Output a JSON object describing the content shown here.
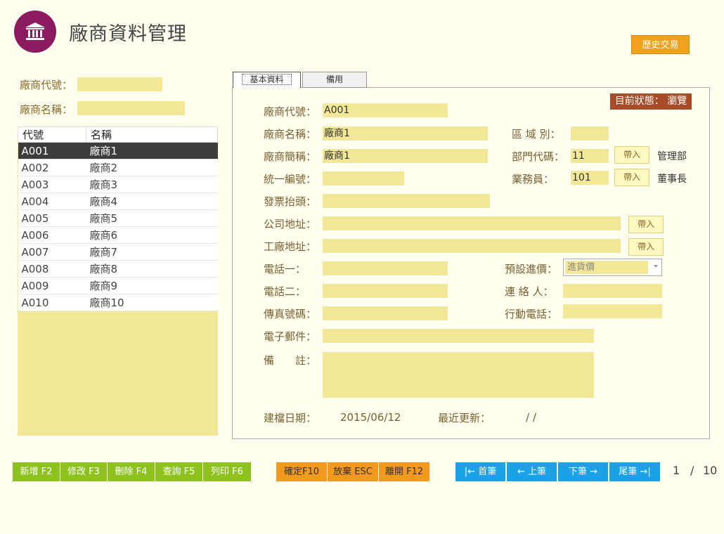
{
  "header": {
    "title": "廠商資料管理",
    "history_button": "歷史交易"
  },
  "filters": {
    "code_label": "廠商代號：",
    "name_label": "廠商名稱："
  },
  "list": {
    "headers": [
      "代號",
      "名稱"
    ],
    "rows": [
      [
        "A001",
        "廠商1"
      ],
      [
        "A002",
        "廠商2"
      ],
      [
        "A003",
        "廠商3"
      ],
      [
        "A004",
        "廠商4"
      ],
      [
        "A005",
        "廠商5"
      ],
      [
        "A006",
        "廠商6"
      ],
      [
        "A007",
        "廠商7"
      ],
      [
        "A008",
        "廠商8"
      ],
      [
        "A009",
        "廠商9"
      ],
      [
        "A010",
        "廠商10"
      ]
    ]
  },
  "tabs": [
    "基本資料",
    "備用"
  ],
  "status": "目前狀態： 瀏覽",
  "form": {
    "code_label": "廠商代號：",
    "code": "A001",
    "name_label": "廠商名稱：",
    "name": "廠商1",
    "short_label": "廠商簡稱：",
    "short": "廠商1",
    "taxid_label": "統一編號：",
    "invoice_label": "發票抬頭：",
    "company_addr_label": "公司地址：",
    "factory_addr_label": "工廠地址：",
    "phone1_label": "電話一：",
    "phone2_label": "電話二：",
    "fax_label": "傳真號碼：",
    "email_label": "電子郵件：",
    "note_label": "備　　註：",
    "region_label": "區 域 別：",
    "dept_label": "部門代碼：",
    "dept": "11",
    "dept_name": "管理部",
    "sales_label": "業務員：",
    "sales": "101",
    "sales_name": "董事長",
    "price_label": "預設進價：",
    "price_value": "進貨價",
    "contact_label": "連 絡 人：",
    "mobile_label": "行動電話：",
    "import_label": "帶入",
    "created_label": "建檔日期：",
    "created": "2015/06/12",
    "updated_label": "最近更新：",
    "updated": "/ /"
  },
  "buttons": {
    "add": "新增 F2",
    "edit": "修改 F3",
    "delete": "刪除 F4",
    "query": "查詢 F5",
    "print": "列印 F6",
    "confirm": "確定F10",
    "cancel": "放棄 ESC",
    "exit": "離開 F12",
    "first": "|← 首筆",
    "prev": "← 上筆",
    "next": "下筆 →",
    "last": "尾筆 →|"
  },
  "pager": {
    "current": "1",
    "sep": "/",
    "total": "10"
  }
}
